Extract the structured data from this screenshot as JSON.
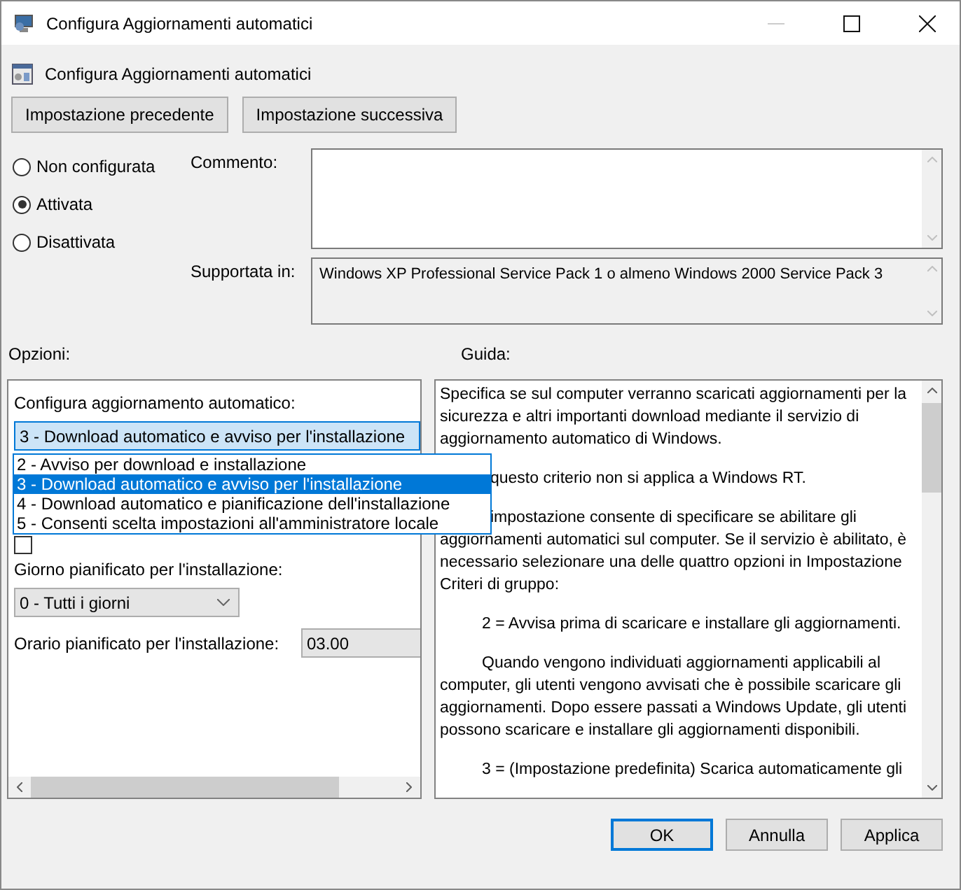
{
  "window": {
    "title": "Configura Aggiornamenti automatici"
  },
  "header": {
    "title": "Configura Aggiornamenti automatici"
  },
  "nav_buttons": [
    "Impostazione precedente",
    "Impostazione successiva"
  ],
  "state_options": [
    {
      "label": "Non configurata",
      "selected": false
    },
    {
      "label": "Attivata",
      "selected": true
    },
    {
      "label": "Disattivata",
      "selected": false
    }
  ],
  "comment": {
    "label": "Commento:"
  },
  "supported": {
    "label": "Supportata in:",
    "value": "Windows XP Professional Service Pack 1 o almeno Windows 2000 Service Pack 3"
  },
  "options": {
    "label": "Opzioni:",
    "config_label": "Configura aggiornamento automatico:",
    "config_value": "3 - Download automatico e avviso per l'installazione",
    "dropdown_items": [
      {
        "label": "2 - Avviso per download e installazione",
        "selected": false
      },
      {
        "label": "3 - Download automatico e avviso per l'installazione",
        "selected": true
      },
      {
        "label": "4 - Download automatico e pianificazione dell'installazione",
        "selected": false
      },
      {
        "label": "5 - Consenti scelta impostazioni all'amministratore locale",
        "selected": false
      }
    ],
    "checkbox_checked": false,
    "day_label": "Giorno pianificato per l'installazione:",
    "day_value": "0 - Tutti i giorni",
    "time_label": "Orario pianificato per l'installazione:",
    "time_value": "03.00"
  },
  "help": {
    "label": "Guida:",
    "paragraphs": [
      {
        "kind": "plain",
        "text": "Specifica se sul computer verranno scaricati aggiornamenti per la sicurezza e altri importanti download mediante il servizio di aggiornamento automatico di Windows."
      },
      {
        "kind": "covered",
        "text": "questo criterio non si applica a Windows RT."
      },
      {
        "kind": "covered",
        "text": "impostazione consente di specificare se abilitare gli aggiornamenti automatici sul computer. Se il servizio è abilitato, è necessario selezionare una delle quattro opzioni in Impostazione Criteri di gruppo:"
      },
      {
        "kind": "indented",
        "text": "2 = Avvisa prima di scaricare e installare gli aggiornamenti."
      },
      {
        "kind": "indented",
        "text": "Quando vengono individuati aggiornamenti applicabili al computer, gli utenti vengono avvisati che è possibile scaricare gli aggiornamenti. Dopo essere passati a Windows Update, gli utenti possono scaricare e installare gli aggiornamenti disponibili."
      },
      {
        "kind": "indented",
        "text": "3 = (Impostazione predefinita) Scarica automaticamente gli"
      }
    ]
  },
  "buttons": [
    {
      "label": "OK",
      "default": true
    },
    {
      "label": "Annulla",
      "default": false
    },
    {
      "label": "Applica",
      "default": false
    }
  ]
}
